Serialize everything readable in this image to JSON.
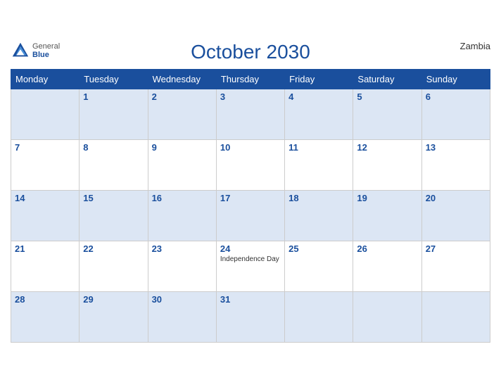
{
  "header": {
    "title": "October 2030",
    "country": "Zambia",
    "logo": {
      "general": "General",
      "blue": "Blue"
    }
  },
  "weekdays": [
    "Monday",
    "Tuesday",
    "Wednesday",
    "Thursday",
    "Friday",
    "Saturday",
    "Sunday"
  ],
  "weeks": [
    [
      {
        "day": "",
        "holiday": ""
      },
      {
        "day": "1",
        "holiday": ""
      },
      {
        "day": "2",
        "holiday": ""
      },
      {
        "day": "3",
        "holiday": ""
      },
      {
        "day": "4",
        "holiday": ""
      },
      {
        "day": "5",
        "holiday": ""
      },
      {
        "day": "6",
        "holiday": ""
      }
    ],
    [
      {
        "day": "7",
        "holiday": ""
      },
      {
        "day": "8",
        "holiday": ""
      },
      {
        "day": "9",
        "holiday": ""
      },
      {
        "day": "10",
        "holiday": ""
      },
      {
        "day": "11",
        "holiday": ""
      },
      {
        "day": "12",
        "holiday": ""
      },
      {
        "day": "13",
        "holiday": ""
      }
    ],
    [
      {
        "day": "14",
        "holiday": ""
      },
      {
        "day": "15",
        "holiday": ""
      },
      {
        "day": "16",
        "holiday": ""
      },
      {
        "day": "17",
        "holiday": ""
      },
      {
        "day": "18",
        "holiday": ""
      },
      {
        "day": "19",
        "holiday": ""
      },
      {
        "day": "20",
        "holiday": ""
      }
    ],
    [
      {
        "day": "21",
        "holiday": ""
      },
      {
        "day": "22",
        "holiday": ""
      },
      {
        "day": "23",
        "holiday": ""
      },
      {
        "day": "24",
        "holiday": "Independence Day"
      },
      {
        "day": "25",
        "holiday": ""
      },
      {
        "day": "26",
        "holiday": ""
      },
      {
        "day": "27",
        "holiday": ""
      }
    ],
    [
      {
        "day": "28",
        "holiday": ""
      },
      {
        "day": "29",
        "holiday": ""
      },
      {
        "day": "30",
        "holiday": ""
      },
      {
        "day": "31",
        "holiday": ""
      },
      {
        "day": "",
        "holiday": ""
      },
      {
        "day": "",
        "holiday": ""
      },
      {
        "day": "",
        "holiday": ""
      }
    ]
  ]
}
